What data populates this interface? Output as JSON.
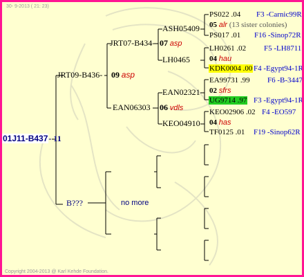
{
  "header": {
    "date": "30-  9-2013 ( 21: 23)"
  },
  "footer": {
    "copyright": "Copyright 2004-2013 @ Karl Kehde Foundation."
  },
  "root": {
    "id": "01J11-B437",
    "gen": "11"
  },
  "sire": {
    "id": "JRT09-B436",
    "gen": "09",
    "name": "asp"
  },
  "dam": {
    "id": "B???",
    "more": "no more"
  },
  "sire_sire": {
    "id": "JRT07-B434",
    "gen": "07",
    "name": "asp"
  },
  "sire_dam": {
    "id": "EAN06303",
    "gen": "06",
    "name": "vdls"
  },
  "ggp": {
    "ssss": "ASH05409",
    "sssd": "LH0465",
    "ssds": "EAN02321",
    "ssdd": "KEO04910"
  },
  "g5": {
    "r1": {
      "id": "PS022",
      "year": ".04",
      "loc": "F3 -Carnic99R"
    },
    "r2": {
      "gen": "05",
      "name": "alr",
      "note": "(13 sister colonies)"
    },
    "r3": {
      "id": "PS017",
      "year": ".01",
      "loc": "F16 -Sinop72R"
    },
    "r4": {
      "id": "LH0261",
      "year": ".02",
      "loc": "F5 -LH8711"
    },
    "r5": {
      "gen": "04",
      "name": "hau"
    },
    "r6": {
      "id": "KDK0004",
      "year": ".00",
      "loc": "F4 -Egypt94-1R"
    },
    "r7": {
      "id": "EA99731",
      "year": ".99",
      "loc": "F6 -B-3447"
    },
    "r8": {
      "gen": "02",
      "name": "sfrs"
    },
    "r9": {
      "id": "UG9714",
      "year": ".97",
      "loc": "F3 -Egypt94-1R"
    },
    "r10": {
      "id": "KEO02906",
      "year": ".02",
      "loc": "F4 -EO597"
    },
    "r11": {
      "gen": "04",
      "name": "has"
    },
    "r12": {
      "id": "TF0125",
      "year": ".01",
      "loc": "F19 -Sinop62R"
    }
  },
  "colors": {
    "frame": "#ff1493",
    "background": "#ffffd0",
    "highlight_yellow": "#ffff00",
    "highlight_green": "#22cc22"
  }
}
